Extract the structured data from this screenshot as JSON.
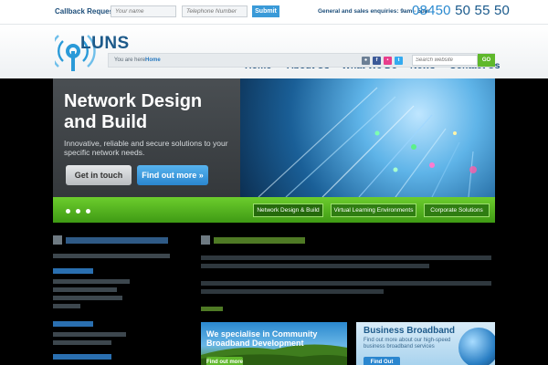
{
  "topbar": {
    "callback_label": "Callback Request",
    "name_placeholder": "Your name",
    "phone_placeholder": "Telephone Number",
    "submit_label": "Submit",
    "enquiries": "General and sales enquiries: 9am - 5pm",
    "phone_prefix": "08450",
    "phone_number": "50 55 50"
  },
  "header": {
    "logo_text": "LUNS",
    "nav": [
      "Home",
      "About Us",
      "What We Do",
      "News",
      "Contact Us"
    ]
  },
  "crumbs": {
    "label": "You are here:",
    "home": "Home",
    "search_placeholder": "Search website",
    "go_label": "GO",
    "social_icons": [
      "facebook-icon",
      "flickr-icon",
      "twitter-icon",
      "linkedin-icon"
    ]
  },
  "hero": {
    "title": "Network Design and Build",
    "subtitle": "Innovative, reliable and secure solutions to your specific network needs.",
    "btn_contact": "Get in touch",
    "btn_more": "Find out more »",
    "slider_dots": 3,
    "tabs": [
      "Network Design & Build",
      "Virtual Learning Environments",
      "Corporate Solutions"
    ]
  },
  "promos": {
    "community_tag": "We",
    "community_title": "We specialise in Community Broadband Development",
    "community_btn": "Find out more",
    "broadband_title": "Business Broadband",
    "broadband_sub": "Find out more about our high-speed business broadband services",
    "broadband_btn": "Find Out More"
  },
  "colors": {
    "brand_blue": "#1d5a8a",
    "accent_blue": "#2a86cf",
    "accent_green": "#5fb82b"
  }
}
